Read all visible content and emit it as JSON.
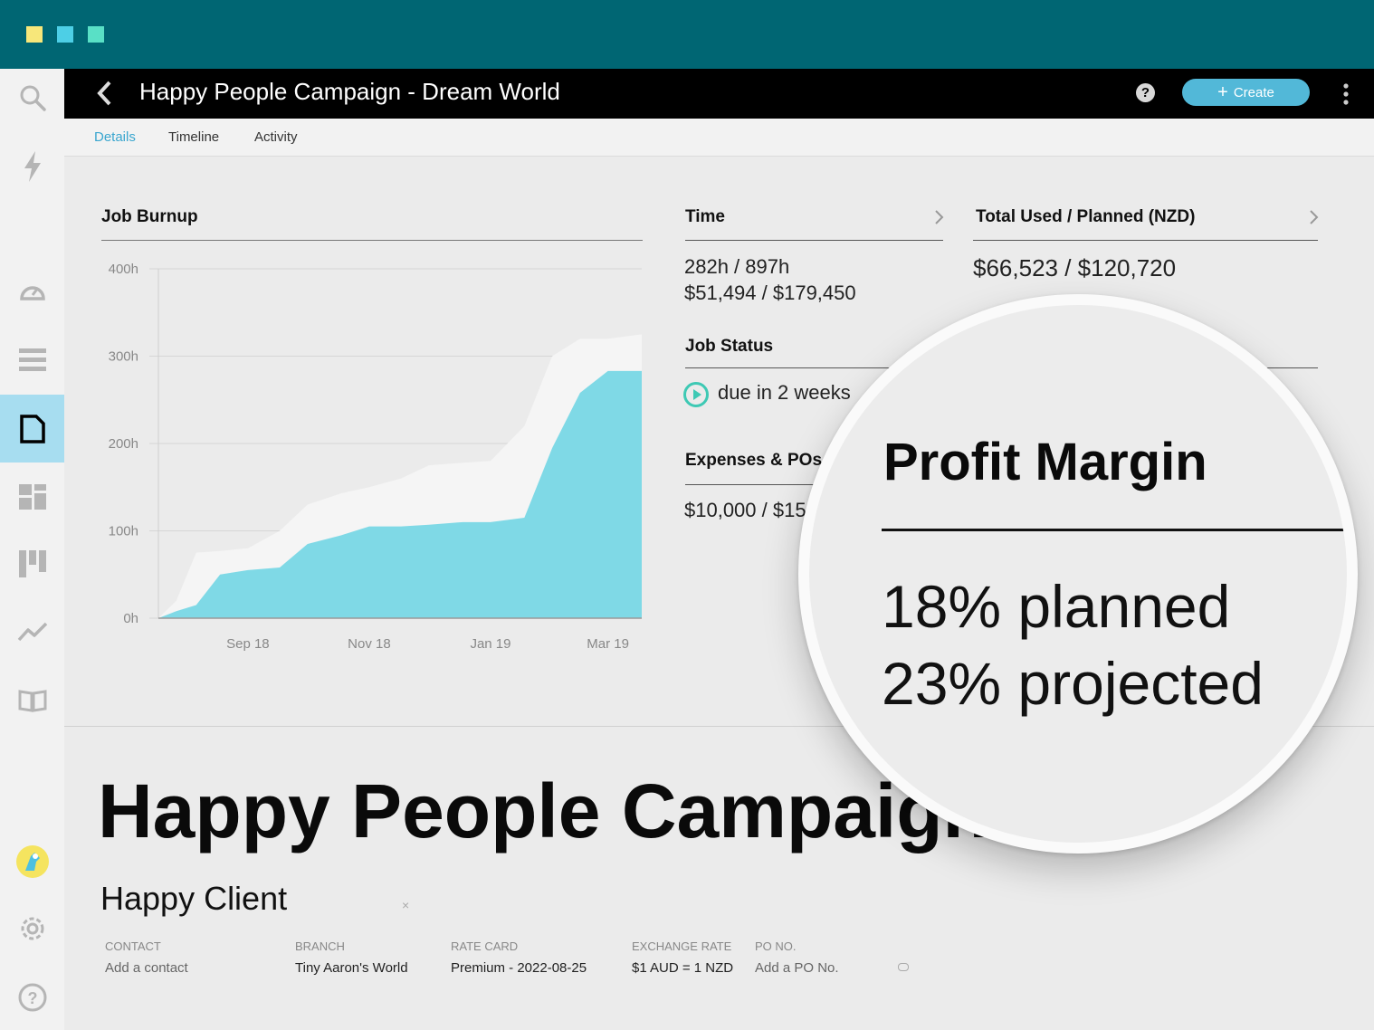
{
  "header": {
    "title": "Happy People Campaign - Dream World",
    "help_label": "?",
    "create_label": "Create"
  },
  "tabs": [
    {
      "label": "Details",
      "active": true
    },
    {
      "label": "Timeline",
      "active": false
    },
    {
      "label": "Activity",
      "active": false
    }
  ],
  "sidebar": {
    "items": [
      {
        "icon": "search-icon"
      },
      {
        "icon": "lightning-icon"
      },
      {
        "icon": "dashboard-gauge-icon"
      },
      {
        "icon": "list-icon"
      },
      {
        "icon": "document-icon",
        "active": true
      },
      {
        "icon": "layout-icon"
      },
      {
        "icon": "board-icon"
      },
      {
        "icon": "trend-icon"
      },
      {
        "icon": "book-icon"
      },
      {
        "icon": "avatar-icon"
      },
      {
        "icon": "gear-icon"
      },
      {
        "icon": "help-icon"
      }
    ]
  },
  "burnup": {
    "title": "Job Burnup"
  },
  "chart_data": {
    "type": "area",
    "x": [
      "2018-08-01",
      "2018-08-10",
      "2018-08-20",
      "2018-09-01",
      "2018-09-15",
      "2018-10-01",
      "2018-10-15",
      "2018-11-01",
      "2018-11-15",
      "2018-12-01",
      "2018-12-15",
      "2019-01-01",
      "2019-01-15",
      "2019-02-01",
      "2019-02-15",
      "2019-03-01",
      "2019-03-15",
      "2019-04-01"
    ],
    "x_ticks": [
      "Sep 18",
      "Nov 18",
      "Jan 19",
      "Mar 19"
    ],
    "y_ticks": [
      "0h",
      "100h",
      "200h",
      "300h",
      "400h"
    ],
    "ylim": [
      0,
      400
    ],
    "series": [
      {
        "values": [
          0,
          20,
          75,
          77,
          80,
          100,
          130,
          143,
          150,
          160,
          175,
          178,
          180,
          220,
          300,
          320,
          320,
          325
        ],
        "color": "#f5f5f5"
      },
      {
        "values": [
          0,
          8,
          15,
          50,
          55,
          58,
          85,
          95,
          105,
          105,
          107,
          110,
          110,
          115,
          195,
          258,
          283,
          283
        ],
        "color": "#7fd9e6"
      }
    ],
    "grid": true
  },
  "time_panel": {
    "title": "Time",
    "line1": "282h / 897h",
    "line2": "$51,494 / $179,450"
  },
  "total_panel": {
    "title": "Total Used / Planned (NZD)",
    "value": "$66,523 / $120,720"
  },
  "status_panel": {
    "title": "Job Status",
    "value": "due in 2 weeks"
  },
  "expenses_panel": {
    "title": "Expenses & POs",
    "value": "$10,000 / $15"
  },
  "job": {
    "title": "Happy People Campaign",
    "client": "Happy Client",
    "clear_label": "×"
  },
  "meta": [
    {
      "label": "CONTACT",
      "value": "Add a contact",
      "muted": true
    },
    {
      "label": "BRANCH",
      "value": "Tiny Aaron's World",
      "muted": false
    },
    {
      "label": "RATE CARD",
      "value": "Premium - 2022-08-25",
      "muted": false
    },
    {
      "label": "EXCHANGE RATE",
      "value": "$1 AUD = 1 NZD",
      "muted": false
    },
    {
      "label": "PO NO.",
      "value": "Add a PO No.",
      "muted": true
    }
  ],
  "magnifier": {
    "title": "Profit Margin",
    "line1": "18% planned",
    "line2": "23% projected"
  },
  "colors": {
    "topbar": "#006673",
    "accent": "#52b8d8",
    "active_nav": "#a7ddf0",
    "burnup_fill": "#7fd9e6",
    "window_dots": [
      "#f7e77a",
      "#4dcfe6",
      "#59e0c6"
    ]
  }
}
